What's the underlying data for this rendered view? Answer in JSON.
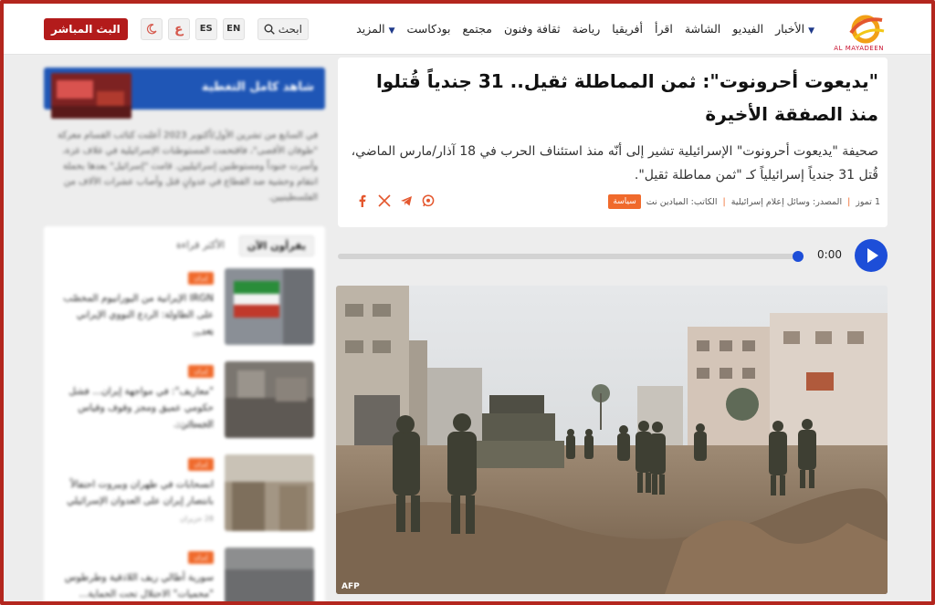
{
  "navbar": {
    "logo_text": "AL MAYADEEN",
    "links": [
      {
        "label": "الأخبار",
        "has_caret": true
      },
      {
        "label": "الفيديو"
      },
      {
        "label": "الشاشة"
      },
      {
        "label": "اقرأ"
      },
      {
        "label": "أفريقيا"
      },
      {
        "label": "رياضة"
      },
      {
        "label": "ثقافة وفنون"
      },
      {
        "label": "مجتمع"
      },
      {
        "label": "بودكاست"
      },
      {
        "label": "المزيد",
        "has_caret": true
      }
    ],
    "search_label": "ابحث",
    "lang_en": "EN",
    "lang_es": "ES",
    "lang_ar": "ع",
    "theme_icon": "moon-icon",
    "live_label": "البث المباشر"
  },
  "article": {
    "headline": "\"يديعوت أحرونوت\": ثمن المماطلة ثقيل.. 31 جندياً قُتلوا منذ الصفقة الأخيرة",
    "lead": "صحيفة \"يديعوت أحرونوت\" الإسرائيلية تشير إلى أنّه منذ استئناف الحرب في 18 آذار/مارس الماضي، قُتل 31 جندياً إسرائيلياً كـ \"ثمن مماطلة ثقيل\".",
    "tag": "سياسة",
    "author": "الكاتب: الميادين نت",
    "source": "المصدر: وسائل إعلام إسرائيلية",
    "date": "1 تموز",
    "share_icons": [
      "whatsapp-icon",
      "telegram-icon",
      "x-icon",
      "facebook-icon"
    ]
  },
  "audio": {
    "time": "0:00",
    "progress": 0
  },
  "photo": {
    "credit": "AFP"
  },
  "sidebar": {
    "watch_title": "شاهد كامل التغطية",
    "watch_desc": "في السابع من تشرين الأول/أكتوبر 2023 أعلنت كتائب القسام معركة \"طوفان الأقصى\"، فاقتحمت المستوطنات الإسرائيلية في غلاف غزة، وأسرت جنوداً ومستوطنين إسرائيليين. قامت \"إسرائيل\" بعدها بحملة انتقام وحشية ضد القطاع في عدوانٍ قتل وأصاب عشرات الآلاف من الفلسطينيين.",
    "tabs": [
      "يقرأون الآن",
      "الأكثر قراءة"
    ],
    "items": [
      {
        "tag": "إيران",
        "text": "IRGN الإيرانية من اليورانيوم المخصّب على الطاولة: الردع النووي الإيراني بعد...",
        "time": "3 تموز"
      },
      {
        "tag": "إيران",
        "text": "\"معاريف\": في مواجهة إيران... فشل حكومي عميق ومجز وقوف وقياس الخسائر...",
        "time": "الأحد 22:00"
      },
      {
        "tag": "إيران",
        "text": "انسحابات في طهران وبيروت احتفالاً بانتصار إيران على العدوان الإسرائيلي",
        "time": "28 حزيران"
      },
      {
        "tag": "إيران",
        "text": "سورية أطالي ريف اللاذقية وطرطوس \"محميات\" الاحتلال تحت الحماية...",
        "time": ""
      }
    ]
  }
}
